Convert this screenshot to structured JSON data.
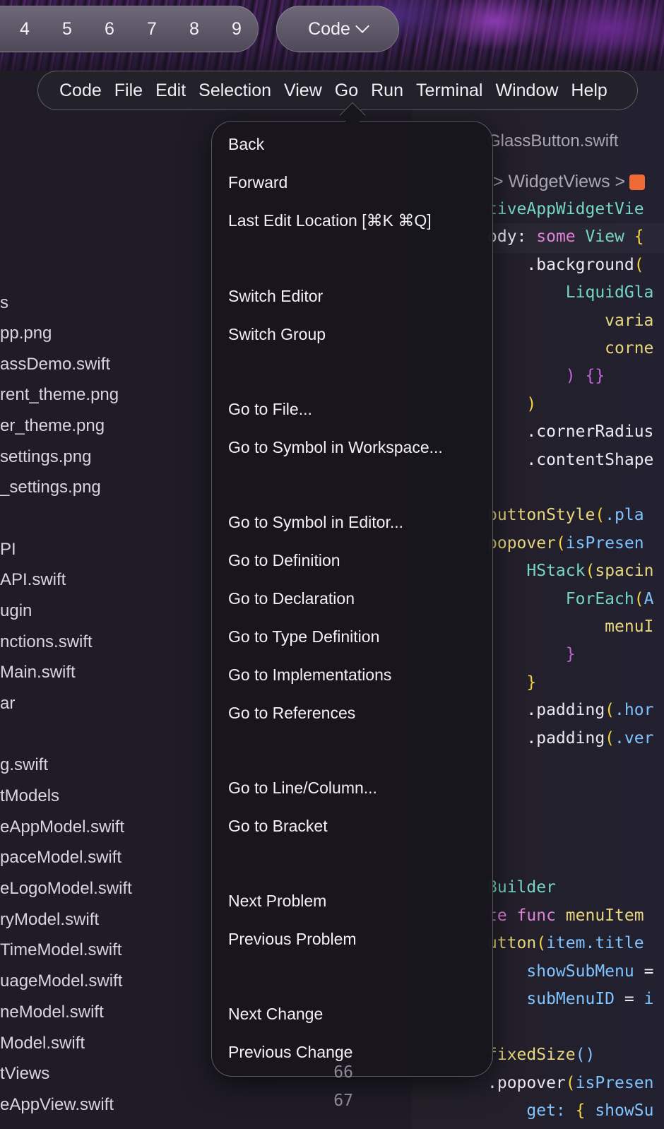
{
  "tab_numbers": [
    "4",
    "5",
    "6",
    "7",
    "8",
    "9"
  ],
  "layout_dropdown": "Code",
  "menubar": [
    "Code",
    "File",
    "Edit",
    "Selection",
    "View",
    "Go",
    "Run",
    "Terminal",
    "Window",
    "Help"
  ],
  "go_menu": {
    "group1": [
      "Back",
      "Forward",
      "Last Edit Location [⌘K ⌘Q]"
    ],
    "group2": [
      "Switch Editor",
      "Switch Group"
    ],
    "group3": [
      "Go to File...",
      "Go to Symbol in Workspace..."
    ],
    "group4": [
      "Go to Symbol in Editor...",
      "Go to Definition",
      "Go to Declaration",
      "Go to Type Definition",
      "Go to Implementations",
      "Go to References"
    ],
    "group5": [
      "Go to Line/Column...",
      "Go to Bracket"
    ],
    "group6": [
      "Next Problem",
      "Previous Problem"
    ],
    "group7": [
      "Next Change",
      "Previous Change"
    ]
  },
  "sidebar_files": [
    "s",
    "pp.png",
    "assDemo.swift",
    "rent_theme.png",
    "er_theme.png",
    "settings.png",
    "_settings.png",
    "PI",
    "API.swift",
    "ugin",
    "nctions.swift",
    "Main.swift",
    "ar",
    "g.swift",
    "tModels",
    "eAppModel.swift",
    "paceModel.swift",
    "eLogoModel.swift",
    "ryModel.swift",
    "TimeModel.swift",
    "uageModel.swift",
    "neModel.swift",
    "Model.swift",
    "tViews",
    "eAppView.swift"
  ],
  "line_numbers": [
    "66",
    "67"
  ],
  "editor": {
    "tab_title": "GlassButton.swift",
    "breadcrumb": "> WidgetViews >"
  },
  "code_lines": [
    {
      "parts": [
        [
          "t",
          "tiveAppWidgetVie"
        ]
      ]
    },
    {
      "parts": [
        [
          "w",
          "ody: "
        ],
        [
          "k",
          "some"
        ],
        [
          "w",
          " "
        ],
        [
          "t",
          "View"
        ],
        [
          "w",
          " "
        ],
        [
          "y",
          "{"
        ]
      ]
    },
    {
      "parts": [
        [
          "w",
          "    .background"
        ],
        [
          "y",
          "("
        ]
      ]
    },
    {
      "parts": [
        [
          "t",
          "        LiquidGla"
        ]
      ]
    },
    {
      "parts": [
        [
          "f",
          "            varia"
        ]
      ]
    },
    {
      "parts": [
        [
          "f",
          "            corne"
        ]
      ]
    },
    {
      "parts": [
        [
          "m",
          "        ) {}"
        ]
      ]
    },
    {
      "parts": [
        [
          "y",
          "    )"
        ]
      ]
    },
    {
      "parts": [
        [
          "w",
          "    .cornerRadius"
        ]
      ]
    },
    {
      "parts": [
        [
          "w",
          "    .contentShape"
        ]
      ]
    },
    {
      "parts": [
        [
          "w",
          ""
        ]
      ]
    },
    {
      "parts": [
        [
          "f",
          "buttonStyle"
        ],
        [
          "y",
          "("
        ],
        [
          "b",
          ".pla"
        ]
      ]
    },
    {
      "parts": [
        [
          "f",
          "popover"
        ],
        [
          "y",
          "("
        ],
        [
          "b",
          "isPresen"
        ]
      ]
    },
    {
      "parts": [
        [
          "t",
          "    HStack"
        ],
        [
          "y",
          "("
        ],
        [
          "f",
          "spacin"
        ]
      ]
    },
    {
      "parts": [
        [
          "t",
          "        ForEach"
        ],
        [
          "y",
          "("
        ],
        [
          "b",
          "A"
        ]
      ]
    },
    {
      "parts": [
        [
          "f",
          "            menuI"
        ]
      ]
    },
    {
      "parts": [
        [
          "m",
          "        }"
        ]
      ]
    },
    {
      "parts": [
        [
          "y",
          "    }"
        ]
      ]
    },
    {
      "parts": [
        [
          "w",
          "    .padding"
        ],
        [
          "y",
          "("
        ],
        [
          "b",
          ".hor"
        ]
      ]
    },
    {
      "parts": [
        [
          "w",
          "    .padding"
        ],
        [
          "y",
          "("
        ],
        [
          "b",
          ".ver"
        ]
      ]
    }
  ],
  "code_lines_lower": [
    {
      "parts": [
        [
          "t",
          "Builder"
        ]
      ]
    },
    {
      "parts": [
        [
          "k",
          "te func "
        ],
        [
          "f",
          "menuItem"
        ]
      ]
    },
    {
      "parts": [
        [
          "f",
          "utton"
        ],
        [
          "y",
          "("
        ],
        [
          "b",
          "item.title"
        ]
      ]
    },
    {
      "parts": [
        [
          "b",
          "    showSubMenu "
        ],
        [
          "w",
          "="
        ]
      ]
    },
    {
      "parts": [
        [
          "b",
          "    subMenuID "
        ],
        [
          "w",
          "= "
        ],
        [
          "b",
          "i"
        ]
      ]
    },
    {
      "parts": [
        [
          "w",
          ""
        ]
      ]
    },
    {
      "parts": [
        [
          "f",
          "fixedSize"
        ],
        [
          "b",
          "()"
        ]
      ]
    },
    {
      "parts": [
        [
          "w",
          ".popover"
        ],
        [
          "y",
          "("
        ],
        [
          "b",
          "isPresen"
        ]
      ]
    },
    {
      "parts": [
        [
          "b",
          "    get: "
        ],
        [
          "y",
          "{ "
        ],
        [
          "b",
          "showSu"
        ]
      ]
    }
  ]
}
